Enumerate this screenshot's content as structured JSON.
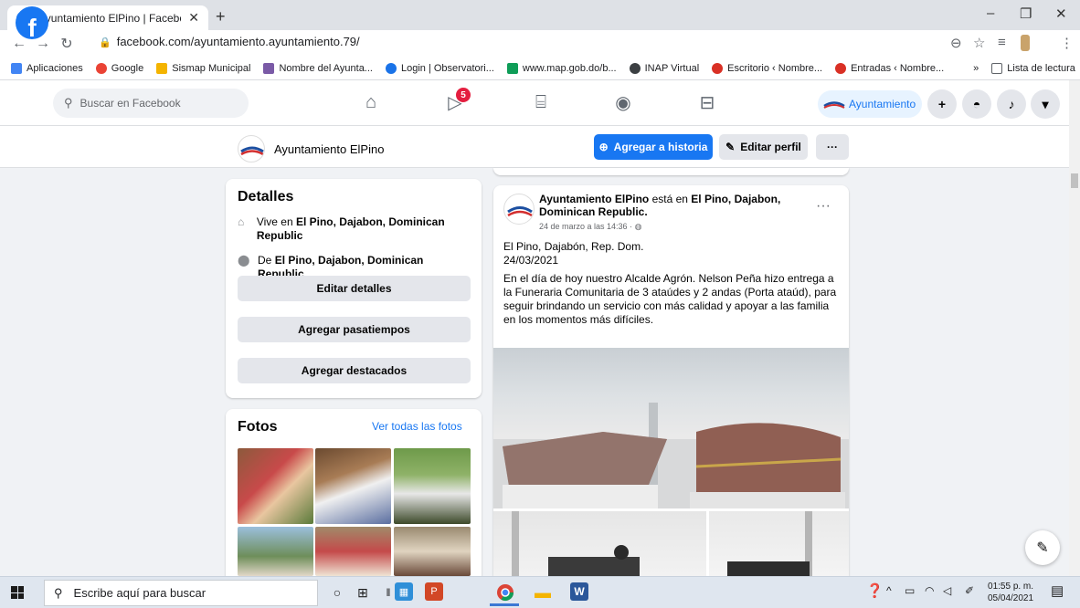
{
  "browser": {
    "tab_title": "Ayuntamiento ElPino | Facebook",
    "url": "facebook.com/ayuntamiento.ayuntamiento.79/",
    "bookmarks": [
      {
        "label": "Aplicaciones",
        "color": "#4285f4"
      },
      {
        "label": "Google",
        "color": "#ea4335"
      },
      {
        "label": "Sismap Municipal",
        "color": "#f4b400"
      },
      {
        "label": "Nombre del Ayunta...",
        "color": "#7a5aa6"
      },
      {
        "label": "Login | Observatori...",
        "color": "#1a73e8"
      },
      {
        "label": "www.map.gob.do/b...",
        "color": "#0f9d58"
      },
      {
        "label": "INAP Virtual",
        "color": "#3c4043"
      },
      {
        "label": "Escritorio ‹ Nombre...",
        "color": "#d93025"
      },
      {
        "label": "Entradas ‹ Nombre...",
        "color": "#d93025"
      }
    ],
    "more_bookmarks": "»",
    "reading_list": "Lista de lectura"
  },
  "facebook": {
    "search_placeholder": "Buscar en Facebook",
    "watch_badge": "5",
    "profile_pill": "Ayuntamiento",
    "page_name": "Ayuntamiento ElPino",
    "add_story": "Agregar a historia",
    "edit_profile": "Editar perfil",
    "more": "···"
  },
  "details": {
    "title": "Detalles",
    "lives_prefix": "Vive en ",
    "lives_place": "El Pino, Dajabon, Dominican Republic",
    "from_prefix": "De ",
    "from_place": "El Pino, Dajabon, Dominican Republic",
    "edit_details": "Editar detalles",
    "add_hobbies": "Agregar pasatiempos",
    "add_featured": "Agregar destacados"
  },
  "photos": {
    "title": "Fotos",
    "see_all": "Ver todas las fotos"
  },
  "post": {
    "author": "Ayuntamiento ElPino",
    "is_in": " está en ",
    "location": "El Pino, Dajabon, Dominican Republic.",
    "time": "24 de marzo a las 14:36 ·",
    "line1": "El Pino, Dajabón, Rep. Dom.",
    "line2": "24/03/2021",
    "body": "En el día de hoy nuestro Alcalde Agrón. Nelson Peña hizo entrega a la Funeraria Comunitaria  de 3 ataúdes y 2 andas (Porta ataúd), para seguir brindando un servicio con más calidad y apoyar a las familia en los momentos más difíciles.",
    "menu": "···"
  },
  "taskbar": {
    "search_placeholder": "Escribe aquí para buscar",
    "time": "01:55 p. m.",
    "date": "05/04/2021"
  },
  "colors": {
    "fb_blue": "#1877f2",
    "badge_red": "#e41e3f",
    "background": "#f0f2f5"
  }
}
